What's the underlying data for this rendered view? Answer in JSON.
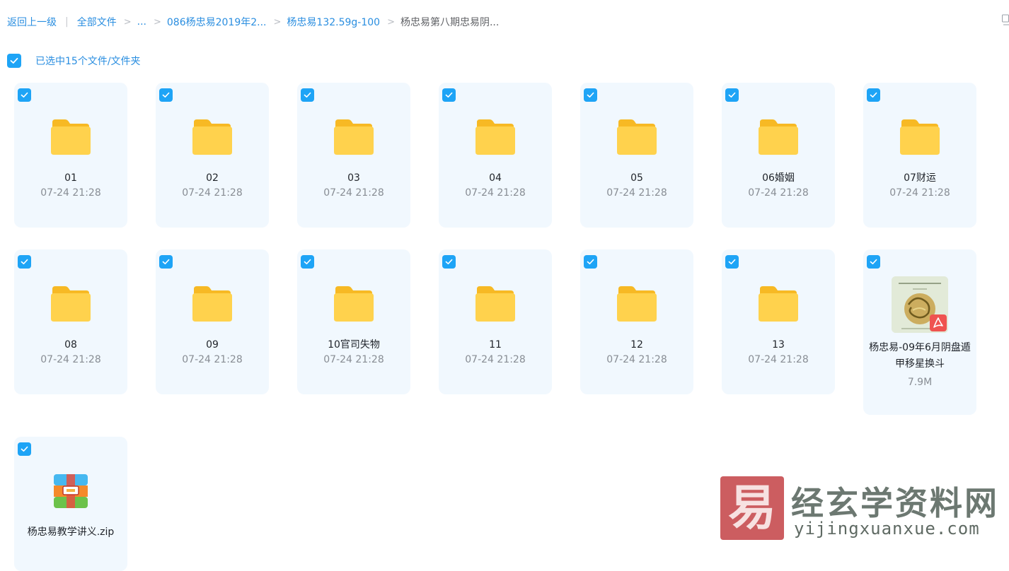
{
  "breadcrumb": {
    "back": "返回上一级",
    "all_files": "全部文件",
    "ellipsis": "...",
    "level1": "086杨忠易2019年2...",
    "level2": "杨忠易132.59g-100",
    "current": "杨忠易第八期忠易阴..."
  },
  "selection": {
    "text": "已选中15个文件/文件夹"
  },
  "items": [
    {
      "name": "01",
      "meta": "07-24 21:28",
      "type": "folder"
    },
    {
      "name": "02",
      "meta": "07-24 21:28",
      "type": "folder"
    },
    {
      "name": "03",
      "meta": "07-24 21:28",
      "type": "folder"
    },
    {
      "name": "04",
      "meta": "07-24 21:28",
      "type": "folder"
    },
    {
      "name": "05",
      "meta": "07-24 21:28",
      "type": "folder"
    },
    {
      "name": "06婚姻",
      "meta": "07-24 21:28",
      "type": "folder"
    },
    {
      "name": "07财运",
      "meta": "07-24 21:28",
      "type": "folder"
    },
    {
      "name": "08",
      "meta": "07-24 21:28",
      "type": "folder"
    },
    {
      "name": "09",
      "meta": "07-24 21:28",
      "type": "folder"
    },
    {
      "name": "10官司失物",
      "meta": "07-24 21:28",
      "type": "folder"
    },
    {
      "name": "11",
      "meta": "07-24 21:28",
      "type": "folder"
    },
    {
      "name": "12",
      "meta": "07-24 21:28",
      "type": "folder"
    },
    {
      "name": "13",
      "meta": "07-24 21:28",
      "type": "folder"
    },
    {
      "name": "杨忠易-09年6月阴盘遁甲移星换斗",
      "meta": "7.9M",
      "type": "pdf"
    },
    {
      "name": "杨忠易教学讲义.zip",
      "meta": "",
      "type": "zip"
    }
  ],
  "watermark": {
    "logo_char": "易",
    "title": "经玄学资料网",
    "url": "yijingxuanxue.com"
  },
  "colors": {
    "accent": "#1ea4f6",
    "link": "#2a8ee0",
    "card_bg": "#f1f8fe",
    "folder": "#ffcc33"
  }
}
